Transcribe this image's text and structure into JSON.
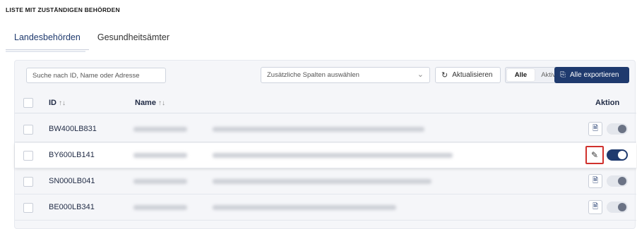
{
  "section_title": "LISTE MIT ZUSTÄNDIGEN BEHÖRDEN",
  "tabs": [
    {
      "label": "Landesbehörden",
      "active": true
    },
    {
      "label": "Gesundheitsämter",
      "active": false
    }
  ],
  "toolbar": {
    "search_placeholder": "Suche nach ID, Name oder Adresse",
    "columns_placeholder": "Zusätzliche Spalten auswählen",
    "refresh_label": "Aktualisieren",
    "filter_all": "Alle",
    "filter_active": "Aktiv",
    "export_label": "Alle exportieren"
  },
  "table": {
    "headers": {
      "id": "ID",
      "name": "Name",
      "action": "Aktion"
    },
    "sort_icon": "↑↓",
    "rows": [
      {
        "id": "BW400LB831",
        "active": false
      },
      {
        "id": "BY600LB141",
        "active": true
      },
      {
        "id": "SN000LB041",
        "active": false
      },
      {
        "id": "BE000LB341",
        "active": false
      }
    ]
  },
  "colors": {
    "primary": "#1f3a6e",
    "highlight": "#d0312d"
  }
}
